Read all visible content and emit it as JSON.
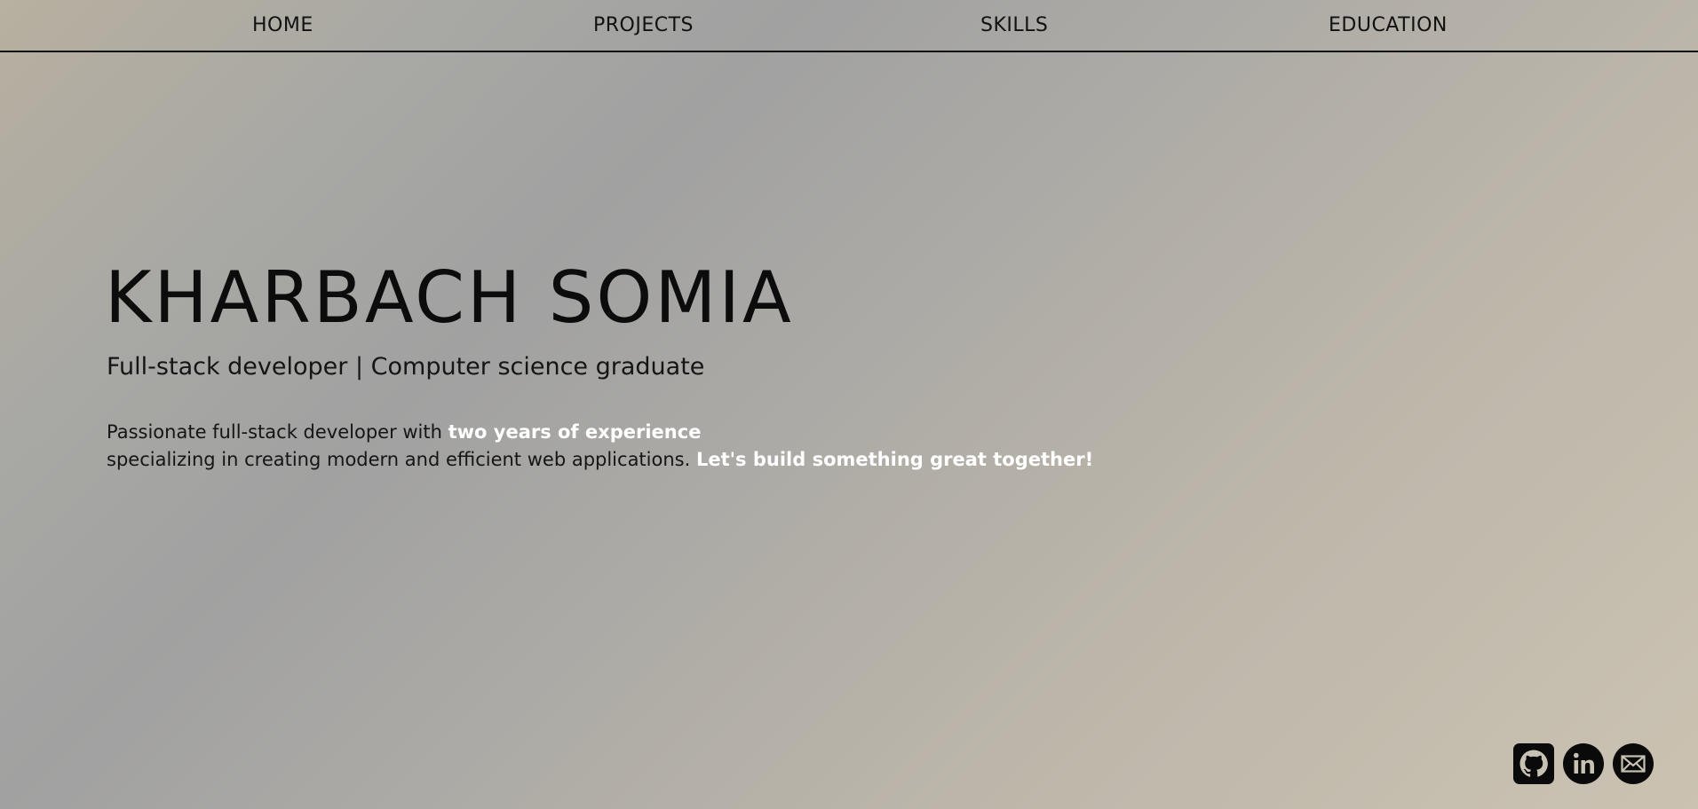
{
  "nav": {
    "items": [
      {
        "label": "HOME"
      },
      {
        "label": "PROJECTS"
      },
      {
        "label": "SKILLS"
      },
      {
        "label": "EDUCATION"
      }
    ]
  },
  "hero": {
    "name": "KHARBACH SOMIA",
    "subtitle": "Full-stack developer | Computer science graduate",
    "bio": {
      "part1": "Passionate full-stack developer with ",
      "highlight1": "two years of experience",
      "part2": "specializing in creating modern and efficient web applications. ",
      "highlight2": "Let's build something great together!"
    }
  },
  "socials": [
    {
      "icon": "github-icon"
    },
    {
      "icon": "linkedin-icon"
    },
    {
      "icon": "mail-icon"
    }
  ],
  "colors": {
    "text": "#111111",
    "highlight": "#ffffff"
  }
}
